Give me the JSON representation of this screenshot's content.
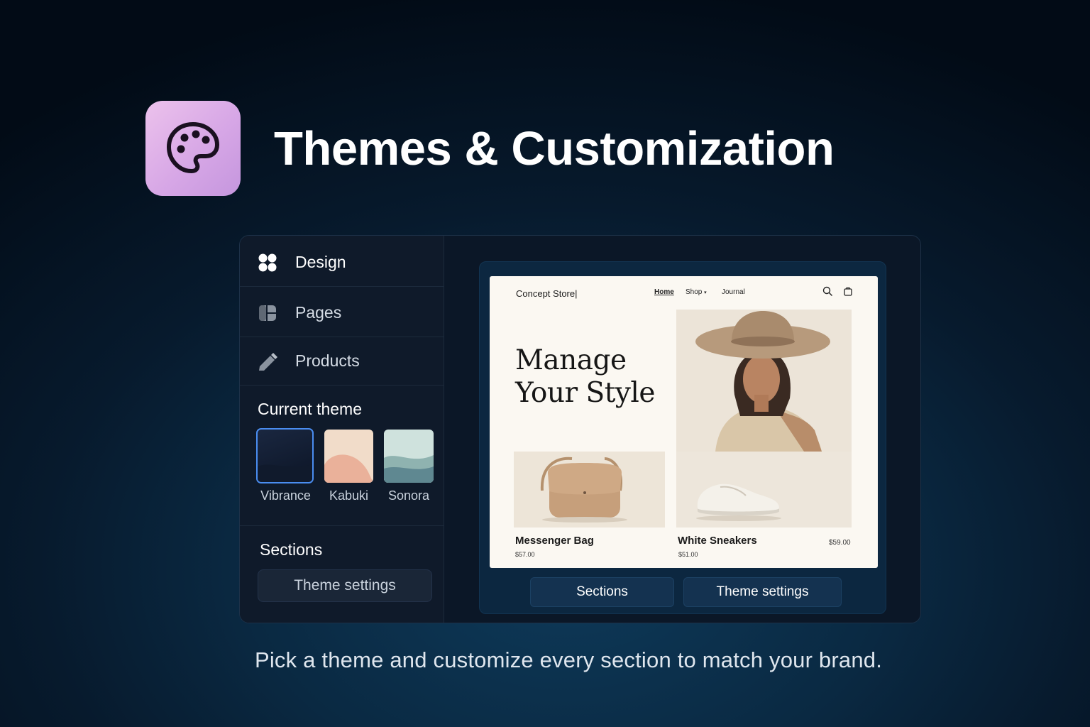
{
  "header": {
    "app_icon": "palette-icon",
    "title": "Themes & Customization",
    "icon_gradient": [
      "#ecc2ec",
      "#c596de"
    ]
  },
  "sidebar": {
    "items": [
      {
        "label": "Design",
        "icon": "grid-dots-icon",
        "active": true
      },
      {
        "label": "Pages",
        "icon": "pages-icon",
        "active": false
      },
      {
        "label": "Products",
        "icon": "pencil-icon",
        "active": false
      }
    ],
    "current_theme_heading": "Current theme",
    "themes": [
      {
        "name": "Vibrance",
        "selected": true
      },
      {
        "name": "Kabuki",
        "selected": false
      },
      {
        "name": "Sonora",
        "selected": false
      }
    ],
    "sections_heading": "Sections",
    "theme_settings_button": "Theme settings"
  },
  "preview": {
    "store_name": "Concept Store|",
    "nav": {
      "home": "Home",
      "shop": "Shop",
      "journal": "Journal"
    },
    "hero_title_line1": "Manage",
    "hero_title_line2": "Your Style",
    "products": [
      {
        "name": "Messenger Bag",
        "price": "$57.00"
      },
      {
        "name": "White Sneakers",
        "price": "$51.00",
        "price_alt": "$59.00"
      }
    ],
    "sections_button": "Sections",
    "theme_settings_button": "Theme settings"
  },
  "caption": "Pick a theme and customize every section to match your brand.",
  "colors": {
    "accent_selected": "#4a8df0",
    "panel_bg": "#0b1727"
  }
}
